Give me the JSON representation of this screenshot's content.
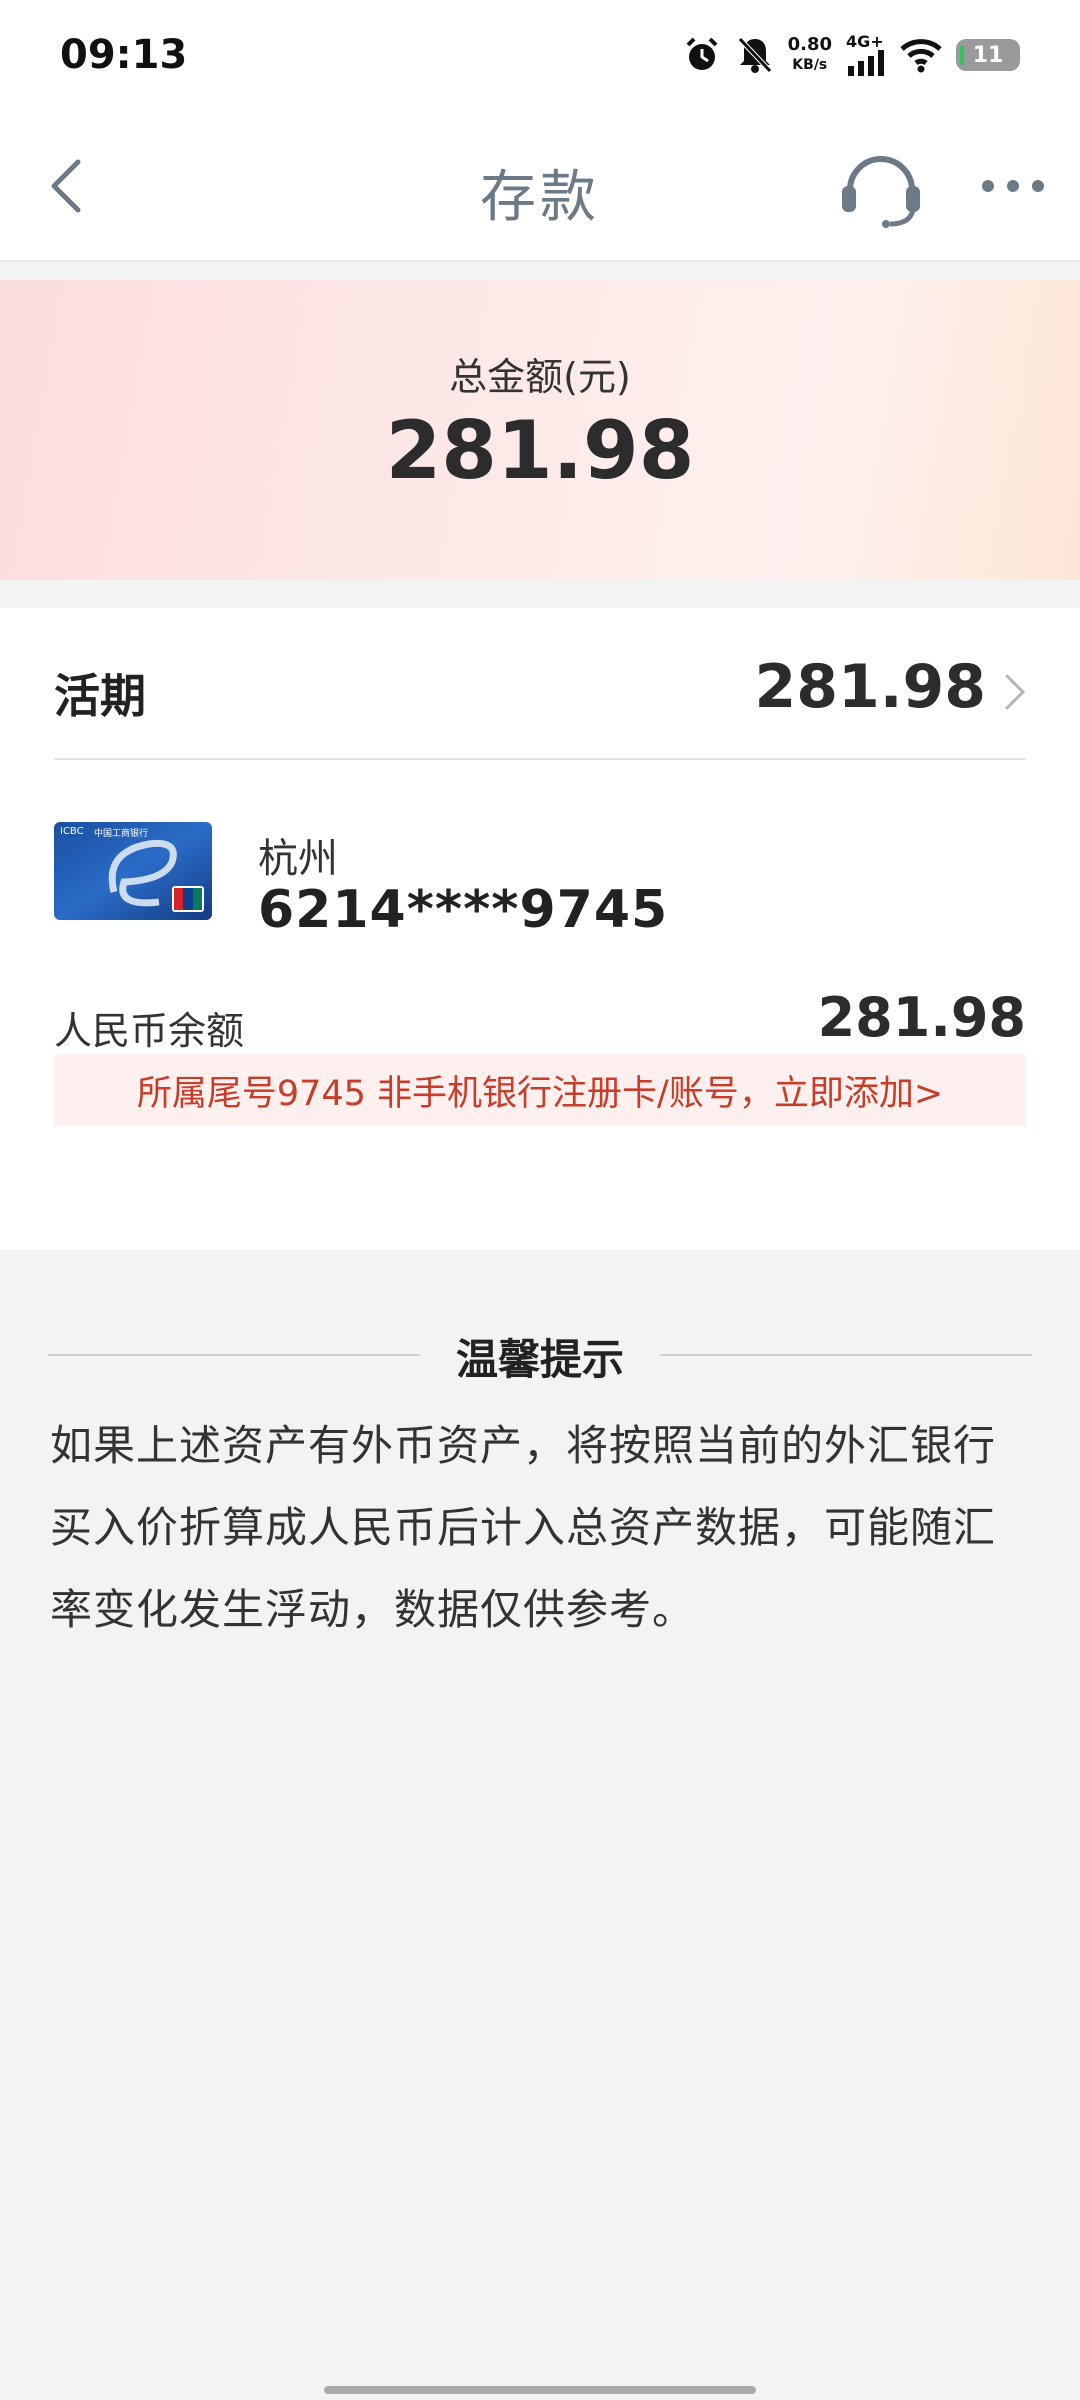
{
  "status_bar": {
    "time": "09:13",
    "speed_value": "0.80",
    "speed_unit": "KB/s",
    "network": "4G+",
    "battery": "11"
  },
  "nav": {
    "title": "存款",
    "back_icon": "chevron-left-icon",
    "support_icon": "headset-icon",
    "more_icon": "more-dots-icon"
  },
  "summary": {
    "label": "总金额(元)",
    "amount": "281.98"
  },
  "current_account": {
    "label": "活期",
    "amount": "281.98"
  },
  "card": {
    "bank_logo_text": "ICBC",
    "bank_name": "中国工商银行",
    "city": "杭州",
    "number": "6214****9745",
    "rmb_label": "人民币余额",
    "rmb_amount": "281.98",
    "notice": "所属尾号9745 非手机银行注册卡/账号，立即添加>"
  },
  "tips": {
    "title": "温馨提示",
    "text": "如果上述资产有外币资产，将按照当前的外汇银行买入价折算成人民币后计入总资产数据，可能随汇率变化发生浮动，数据仅供参考。"
  },
  "colors": {
    "notice_text": "#c63d2a",
    "notice_bg": "#fdf0ee",
    "nav_title": "#6b7a86",
    "summary_gradient_start": "#fbdede",
    "summary_gradient_end": "#fde6d6"
  }
}
